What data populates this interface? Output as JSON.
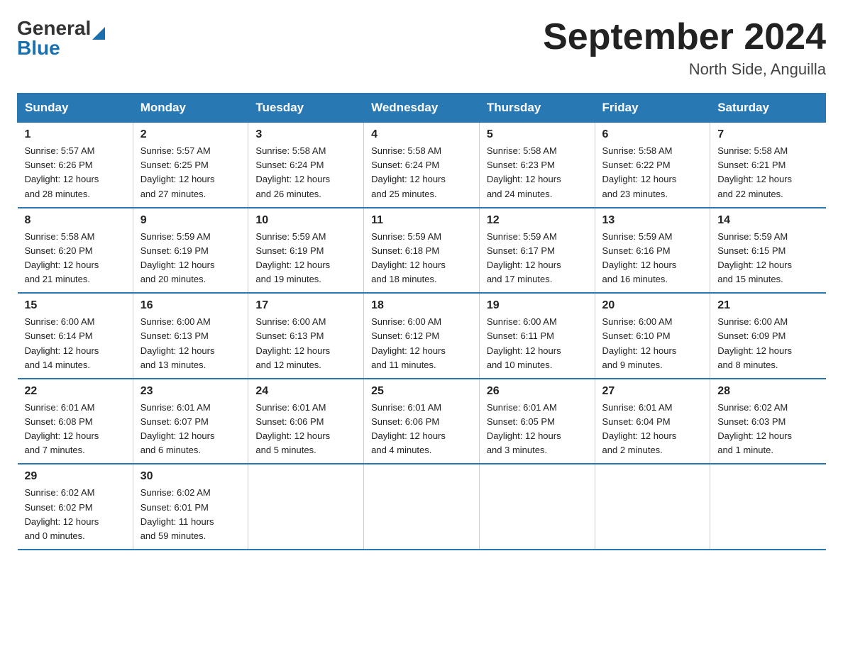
{
  "header": {
    "logo_general": "General",
    "logo_blue": "Blue",
    "month_title": "September 2024",
    "location": "North Side, Anguilla"
  },
  "weekdays": [
    "Sunday",
    "Monday",
    "Tuesday",
    "Wednesday",
    "Thursday",
    "Friday",
    "Saturday"
  ],
  "weeks": [
    [
      {
        "day": "1",
        "sunrise": "5:57 AM",
        "sunset": "6:26 PM",
        "daylight": "12 hours and 28 minutes."
      },
      {
        "day": "2",
        "sunrise": "5:57 AM",
        "sunset": "6:25 PM",
        "daylight": "12 hours and 27 minutes."
      },
      {
        "day": "3",
        "sunrise": "5:58 AM",
        "sunset": "6:24 PM",
        "daylight": "12 hours and 26 minutes."
      },
      {
        "day": "4",
        "sunrise": "5:58 AM",
        "sunset": "6:24 PM",
        "daylight": "12 hours and 25 minutes."
      },
      {
        "day": "5",
        "sunrise": "5:58 AM",
        "sunset": "6:23 PM",
        "daylight": "12 hours and 24 minutes."
      },
      {
        "day": "6",
        "sunrise": "5:58 AM",
        "sunset": "6:22 PM",
        "daylight": "12 hours and 23 minutes."
      },
      {
        "day": "7",
        "sunrise": "5:58 AM",
        "sunset": "6:21 PM",
        "daylight": "12 hours and 22 minutes."
      }
    ],
    [
      {
        "day": "8",
        "sunrise": "5:58 AM",
        "sunset": "6:20 PM",
        "daylight": "12 hours and 21 minutes."
      },
      {
        "day": "9",
        "sunrise": "5:59 AM",
        "sunset": "6:19 PM",
        "daylight": "12 hours and 20 minutes."
      },
      {
        "day": "10",
        "sunrise": "5:59 AM",
        "sunset": "6:19 PM",
        "daylight": "12 hours and 19 minutes."
      },
      {
        "day": "11",
        "sunrise": "5:59 AM",
        "sunset": "6:18 PM",
        "daylight": "12 hours and 18 minutes."
      },
      {
        "day": "12",
        "sunrise": "5:59 AM",
        "sunset": "6:17 PM",
        "daylight": "12 hours and 17 minutes."
      },
      {
        "day": "13",
        "sunrise": "5:59 AM",
        "sunset": "6:16 PM",
        "daylight": "12 hours and 16 minutes."
      },
      {
        "day": "14",
        "sunrise": "5:59 AM",
        "sunset": "6:15 PM",
        "daylight": "12 hours and 15 minutes."
      }
    ],
    [
      {
        "day": "15",
        "sunrise": "6:00 AM",
        "sunset": "6:14 PM",
        "daylight": "12 hours and 14 minutes."
      },
      {
        "day": "16",
        "sunrise": "6:00 AM",
        "sunset": "6:13 PM",
        "daylight": "12 hours and 13 minutes."
      },
      {
        "day": "17",
        "sunrise": "6:00 AM",
        "sunset": "6:13 PM",
        "daylight": "12 hours and 12 minutes."
      },
      {
        "day": "18",
        "sunrise": "6:00 AM",
        "sunset": "6:12 PM",
        "daylight": "12 hours and 11 minutes."
      },
      {
        "day": "19",
        "sunrise": "6:00 AM",
        "sunset": "6:11 PM",
        "daylight": "12 hours and 10 minutes."
      },
      {
        "day": "20",
        "sunrise": "6:00 AM",
        "sunset": "6:10 PM",
        "daylight": "12 hours and 9 minutes."
      },
      {
        "day": "21",
        "sunrise": "6:00 AM",
        "sunset": "6:09 PM",
        "daylight": "12 hours and 8 minutes."
      }
    ],
    [
      {
        "day": "22",
        "sunrise": "6:01 AM",
        "sunset": "6:08 PM",
        "daylight": "12 hours and 7 minutes."
      },
      {
        "day": "23",
        "sunrise": "6:01 AM",
        "sunset": "6:07 PM",
        "daylight": "12 hours and 6 minutes."
      },
      {
        "day": "24",
        "sunrise": "6:01 AM",
        "sunset": "6:06 PM",
        "daylight": "12 hours and 5 minutes."
      },
      {
        "day": "25",
        "sunrise": "6:01 AM",
        "sunset": "6:06 PM",
        "daylight": "12 hours and 4 minutes."
      },
      {
        "day": "26",
        "sunrise": "6:01 AM",
        "sunset": "6:05 PM",
        "daylight": "12 hours and 3 minutes."
      },
      {
        "day": "27",
        "sunrise": "6:01 AM",
        "sunset": "6:04 PM",
        "daylight": "12 hours and 2 minutes."
      },
      {
        "day": "28",
        "sunrise": "6:02 AM",
        "sunset": "6:03 PM",
        "daylight": "12 hours and 1 minute."
      }
    ],
    [
      {
        "day": "29",
        "sunrise": "6:02 AM",
        "sunset": "6:02 PM",
        "daylight": "12 hours and 0 minutes."
      },
      {
        "day": "30",
        "sunrise": "6:02 AM",
        "sunset": "6:01 PM",
        "daylight": "11 hours and 59 minutes."
      },
      null,
      null,
      null,
      null,
      null
    ]
  ],
  "labels": {
    "sunrise": "Sunrise:",
    "sunset": "Sunset:",
    "daylight": "Daylight:"
  }
}
